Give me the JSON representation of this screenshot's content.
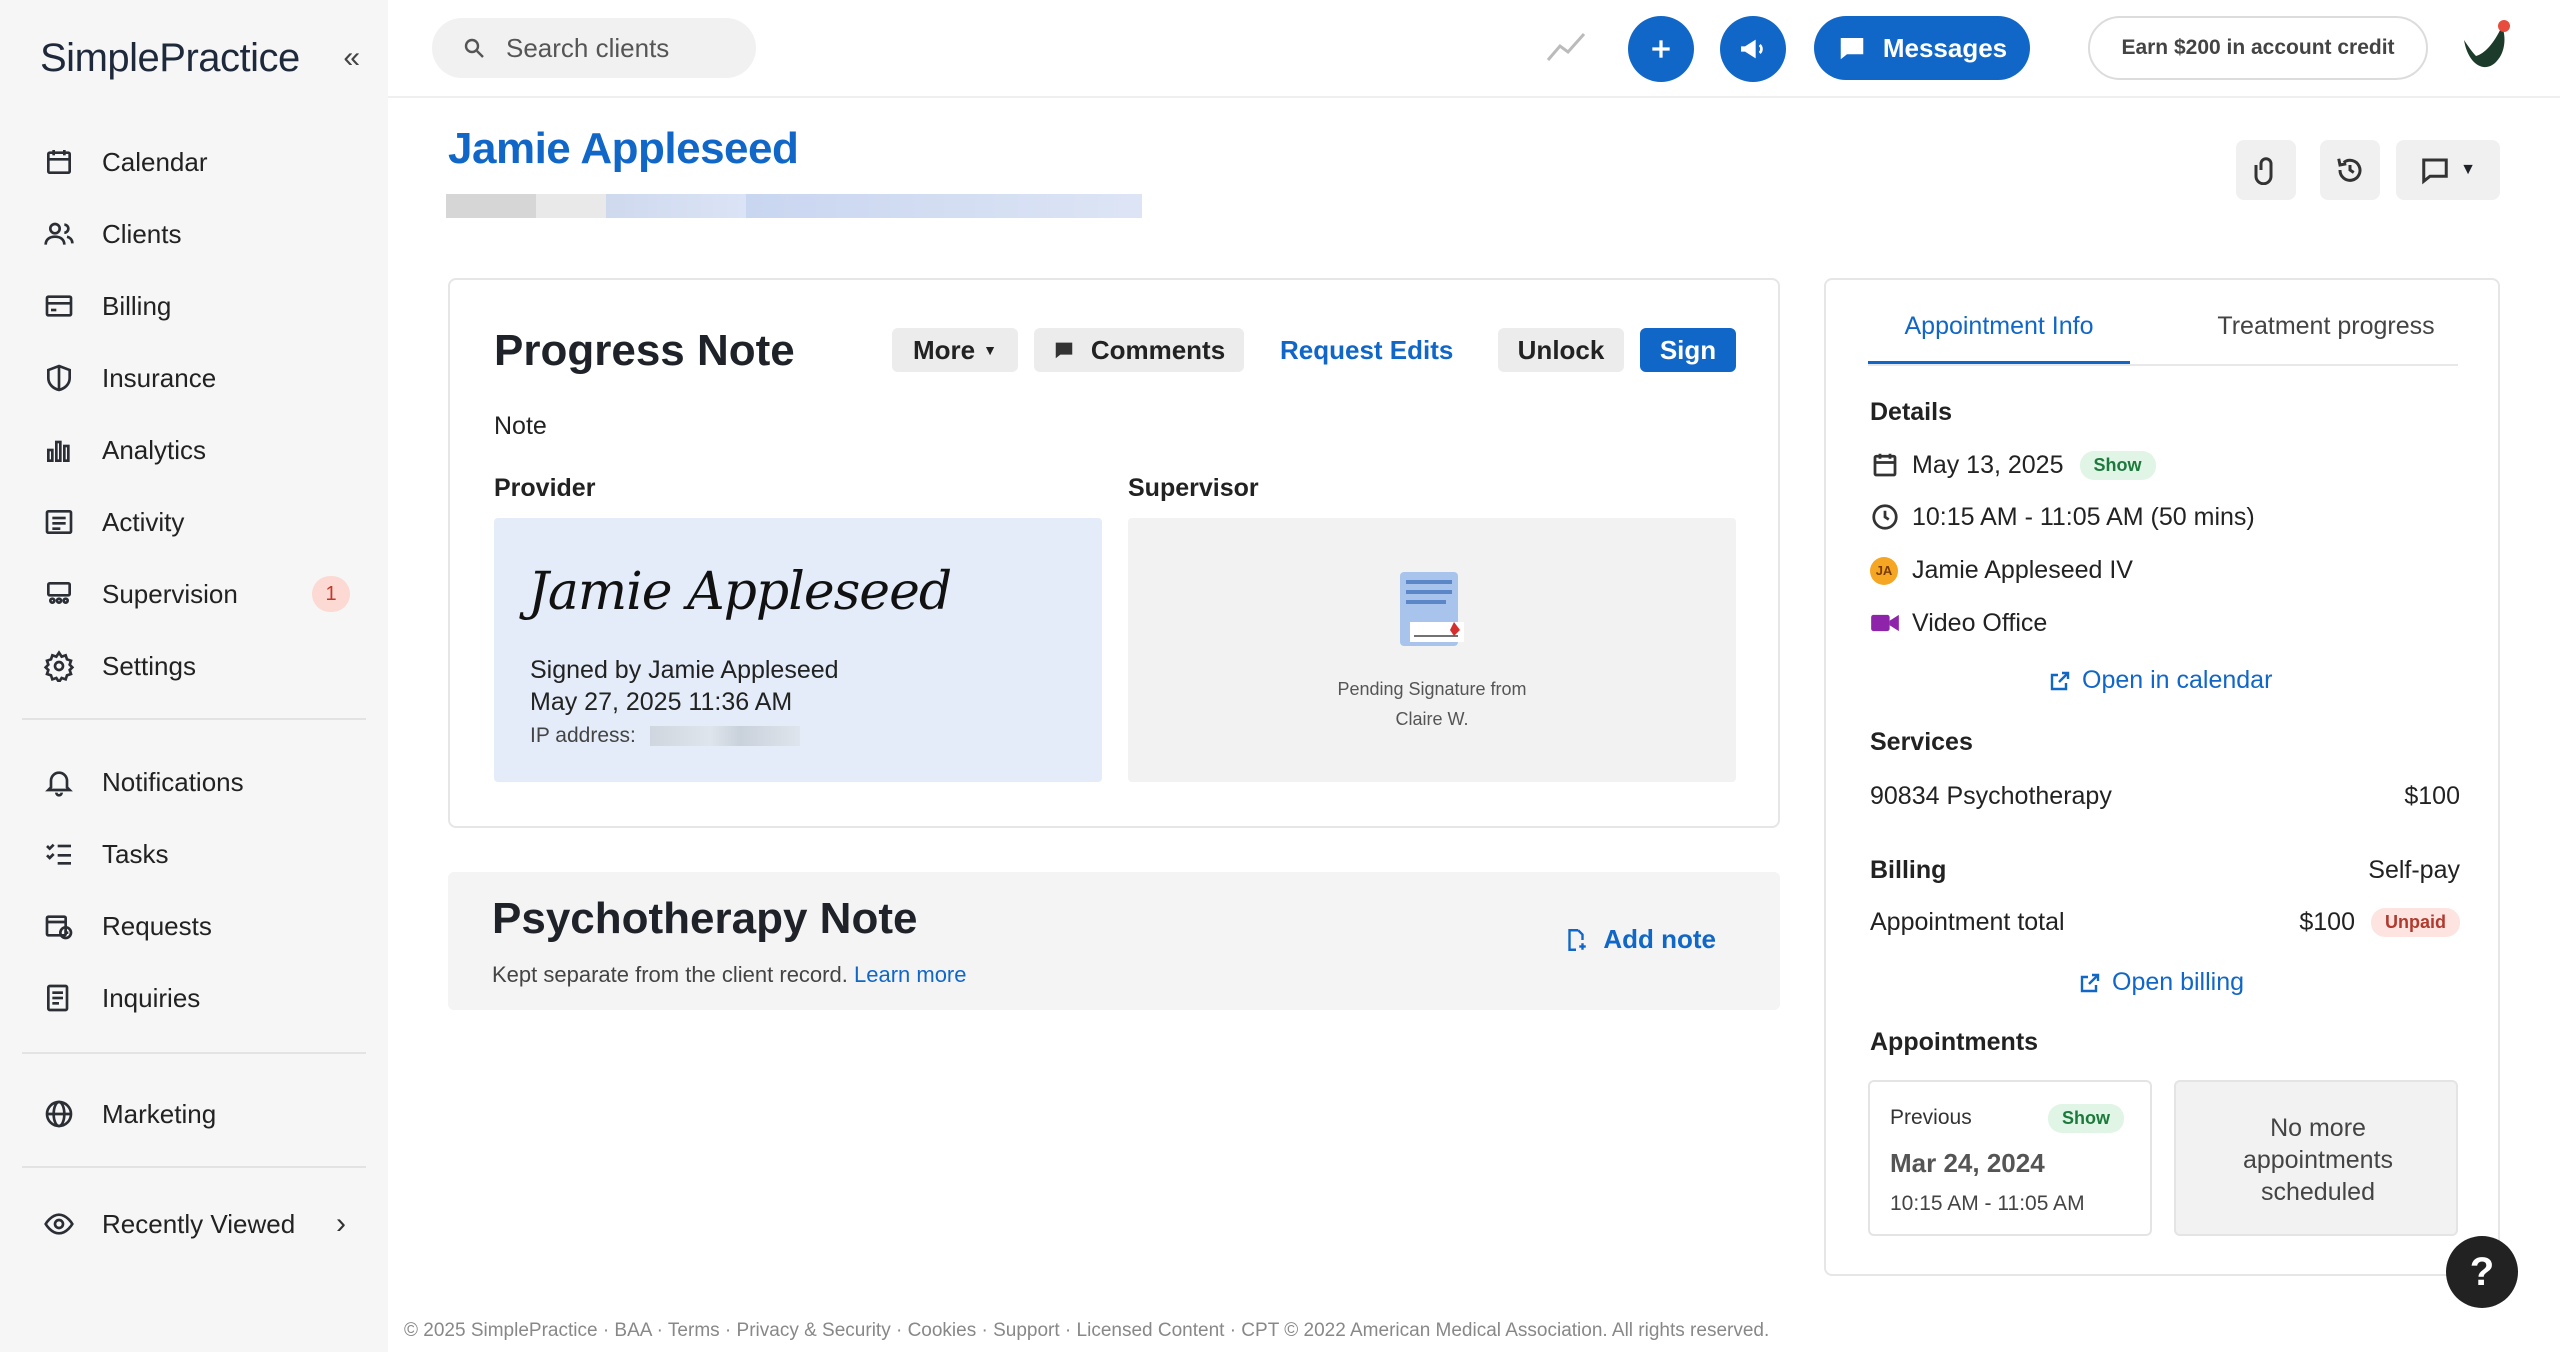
{
  "app": {
    "logo": "SimplePractice",
    "collapse_icon": "double-chevron-left-icon"
  },
  "sidebar": {
    "items": [
      {
        "label": "Calendar",
        "icon": "calendar-icon"
      },
      {
        "label": "Clients",
        "icon": "users-icon"
      },
      {
        "label": "Billing",
        "icon": "credit-card-icon"
      },
      {
        "label": "Insurance",
        "icon": "shield-icon"
      },
      {
        "label": "Analytics",
        "icon": "bar-chart-icon"
      },
      {
        "label": "Activity",
        "icon": "list-icon"
      },
      {
        "label": "Supervision",
        "icon": "team-icon",
        "badge": "1"
      },
      {
        "label": "Settings",
        "icon": "gear-icon"
      }
    ],
    "items2": [
      {
        "label": "Notifications",
        "icon": "bell-icon"
      },
      {
        "label": "Tasks",
        "icon": "checklist-icon"
      },
      {
        "label": "Requests",
        "icon": "calendar-clock-icon"
      },
      {
        "label": "Inquiries",
        "icon": "document-list-icon"
      }
    ],
    "items3": [
      {
        "label": "Marketing",
        "icon": "globe-icon"
      }
    ],
    "recently_viewed": "Recently Viewed"
  },
  "topbar": {
    "search_placeholder": "Search clients",
    "messages_label": "Messages",
    "earn_label": "Earn $200 in account credit"
  },
  "client": {
    "name": "Jamie Appleseed"
  },
  "progress_note": {
    "title": "Progress Note",
    "more_label": "More",
    "comments_label": "Comments",
    "request_edits_label": "Request Edits",
    "unlock_label": "Unlock",
    "sign_label": "Sign",
    "note_label": "Note",
    "provider_label": "Provider",
    "supervisor_label": "Supervisor",
    "signature_script": "Jamie Appleseed",
    "signed_by": "Signed by Jamie Appleseed",
    "signed_date": "May 27, 2025 11:36 AM",
    "ip_label": "IP address:",
    "pending_line1": "Pending Signature from",
    "pending_line2": "Claire W."
  },
  "psychotherapy_note": {
    "title": "Psychotherapy Note",
    "subtitle": "Kept separate from the client record.",
    "learn_more": "Learn more",
    "add_note": "Add note"
  },
  "panel": {
    "tabs": [
      {
        "label": "Appointment Info",
        "active": true
      },
      {
        "label": "Treatment progress",
        "active": false
      }
    ],
    "details_label": "Details",
    "date": "May 13, 2025",
    "date_status": "Show",
    "time": "10:15 AM - 11:05 AM (50 mins)",
    "client_initials": "JA",
    "client_full": "Jamie Appleseed IV",
    "location": "Video Office",
    "open_calendar": "Open in calendar",
    "services_label": "Services",
    "service_name": "90834 Psychotherapy",
    "service_price": "$100",
    "billing_label": "Billing",
    "billing_type": "Self-pay",
    "appt_total_label": "Appointment total",
    "appt_total": "$100",
    "appt_total_status": "Unpaid",
    "open_billing": "Open billing",
    "appointments_label": "Appointments",
    "previous": {
      "label": "Previous",
      "status": "Show",
      "date": "Mar 24, 2024",
      "time": "10:15 AM - 11:05 AM"
    },
    "no_more": "No more appointments scheduled"
  },
  "help_label": "?",
  "footer": "© 2025 SimplePractice · BAA · Terms · Privacy & Security · Cookies · Support · Licensed Content · CPT © 2022 American Medical Association. All rights reserved.",
  "colors": {
    "brand_blue": "#1167c7",
    "sidebar_bg": "#f6f6f6",
    "show_green": "#1e7a3c",
    "unpaid_red": "#b03a2e"
  }
}
